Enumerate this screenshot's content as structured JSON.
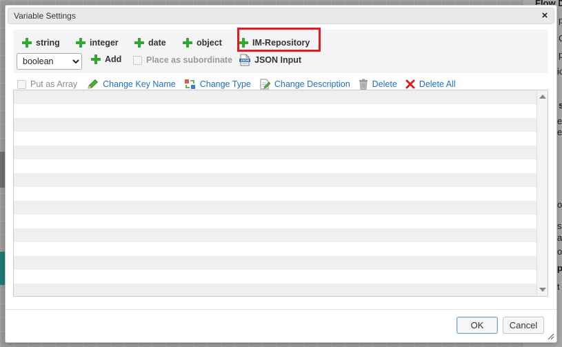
{
  "background": {
    "right_fragments": [
      "Flow D",
      "p",
      "C",
      "p",
      "ic",
      "s",
      "ed",
      "er",
      "ov",
      "se",
      "al",
      "ov",
      "pi",
      "t"
    ]
  },
  "dialog": {
    "title": "Variable Settings",
    "close_glyph": "×"
  },
  "toolbar": {
    "type_buttons": [
      {
        "label": "string",
        "icon": "plus-icon"
      },
      {
        "label": "integer",
        "icon": "plus-icon"
      },
      {
        "label": "date",
        "icon": "plus-icon"
      },
      {
        "label": "object",
        "icon": "plus-icon"
      },
      {
        "label": "IM-Repository",
        "icon": "plus-icon",
        "highlighted": true
      }
    ],
    "type_select": {
      "value": "boolean"
    },
    "add_label": "Add",
    "place_subordinate_label": "Place as subordinate",
    "json_input_label": "JSON Input"
  },
  "actions": {
    "put_as_array_label": "Put as Array",
    "change_key_name": "Change Key Name",
    "change_type": "Change Type",
    "change_description": "Change Description",
    "delete": "Delete",
    "delete_all": "Delete All"
  },
  "footer": {
    "ok_label": "OK",
    "cancel_label": "Cancel"
  },
  "colors": {
    "accent_link": "#1a6fc0",
    "plus_green": "#2faa2f",
    "highlight_red": "#e01b24",
    "delete_red": "#d42020"
  }
}
